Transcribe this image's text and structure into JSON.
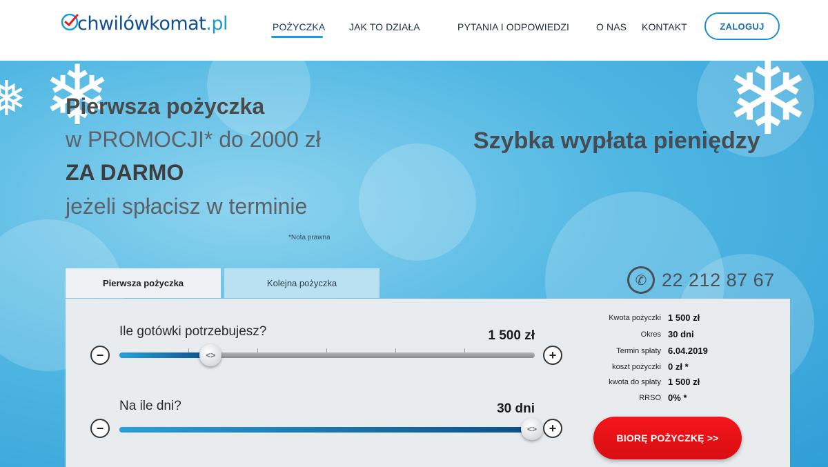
{
  "header": {
    "logo_main": "chwilówkomat",
    "logo_tld": ".pl",
    "nav": [
      {
        "label": "POŻYCZKA",
        "active": true
      },
      {
        "label": "JAK TO DZIAŁA",
        "active": false
      },
      {
        "label": "PYTANIA I ODPOWIEDZI",
        "active": false
      },
      {
        "label": "O NAS",
        "active": false
      },
      {
        "label": "KONTAKT",
        "active": false
      }
    ],
    "login_label": "ZALOGUJ"
  },
  "hero": {
    "line1": "Pierwsza pożyczka",
    "line2": "w PROMOCJI* do 2000 zł",
    "line3": "ZA DARMO",
    "line4": "jeżeli spłacisz w terminie",
    "note": "*Nota prawna",
    "right_headline": "Szybka wypłata pieniędzy"
  },
  "tabs": [
    {
      "label": "Pierwsza pożyczka",
      "active": true
    },
    {
      "label": "Kolejna pożyczka",
      "active": false
    }
  ],
  "phone": {
    "number": "22 212 87 67",
    "icon": "phone-icon"
  },
  "calculator": {
    "amount": {
      "question": "Ile gotówki potrzebujesz?",
      "value": "1 500 zł",
      "fill_fraction": 0.22
    },
    "days": {
      "question": "Na ile dni?",
      "value": "30 dni",
      "fill_fraction": 1.0
    },
    "minus_symbol": "−",
    "plus_symbol": "+",
    "handle_symbol": "<>"
  },
  "summary": [
    {
      "label": "Kwota pożyczki",
      "value": "1 500 zł"
    },
    {
      "label": "Okres",
      "value": "30 dni"
    },
    {
      "label": "Termin spłaty",
      "value": "6.04.2019"
    },
    {
      "label": "koszt pożyczki",
      "value": "0 zł *"
    },
    {
      "label": "kwota do spłaty",
      "value": "1 500 zł"
    },
    {
      "label": "RRSO",
      "value": "0% *"
    }
  ],
  "cta_label": "BIORĘ POŻYCZKĘ >>",
  "colors": {
    "accent": "#1a9bd7",
    "brand_dark": "#0f4f8f",
    "cta": "#e8101a"
  }
}
